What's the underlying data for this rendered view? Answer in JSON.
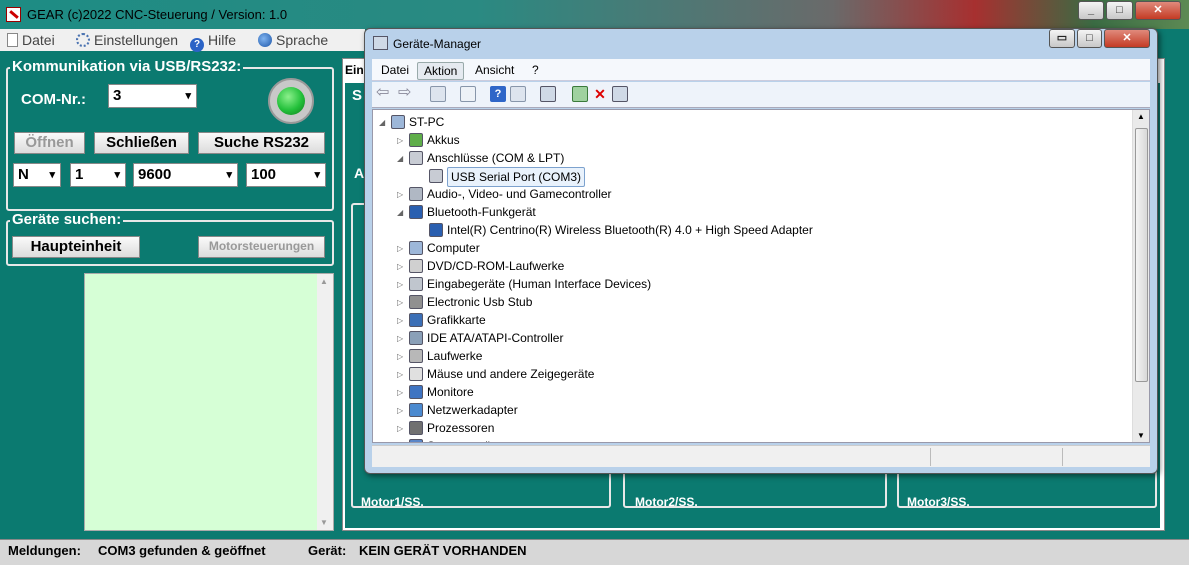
{
  "app": {
    "title": "GEAR (c)2022 CNC-Steuerung / Version: 1.0",
    "window_controls": [
      "_",
      "□",
      "✕"
    ],
    "menu": [
      "Datei",
      "Einstellungen",
      "Hilfe",
      "Sprache"
    ],
    "comm_group": {
      "title": "Kommunikation via USB/RS232:",
      "com_label": "COM-Nr.:",
      "com_value": "3",
      "status_led": "connected",
      "open_button": "Öffnen",
      "close_button": "Schließen",
      "search_button": "Suche RS232",
      "parity": "N",
      "stopbits": "1",
      "baud": "9600",
      "timeout": "100"
    },
    "device_group": {
      "title": "Geräte suchen:",
      "main_unit_button": "Haupteinheit",
      "motor_button": "Motorsteuerungen"
    },
    "right_tab_fragment": "Ein",
    "motor_fragments": [
      "Motor1/SS.",
      "Motor2/SS.",
      "Motor3/SS."
    ],
    "side_fragments": [
      "S",
      "A"
    ],
    "status": {
      "messages_label": "Meldungen:",
      "messages_value": "COM3 gefunden & geöffnet",
      "device_label": "Gerät:",
      "device_value": "KEIN GERÄT VORHANDEN"
    }
  },
  "device_manager": {
    "title": "Geräte-Manager",
    "window_controls": [
      "▭",
      "□",
      "✕"
    ],
    "menu": [
      "Datei",
      "Aktion",
      "Ansicht",
      "?"
    ],
    "active_menu": "Aktion",
    "tree": [
      {
        "label": "ST-PC",
        "level": 0,
        "expander": "◢",
        "icon": "computer-icon"
      },
      {
        "label": "Akkus",
        "level": 1,
        "expander": "▷",
        "icon": "battery-icon"
      },
      {
        "label": "Anschlüsse (COM & LPT)",
        "level": 1,
        "expander": "◢",
        "icon": "port-icon"
      },
      {
        "label": "USB Serial Port (COM3)",
        "level": 2,
        "expander": "",
        "icon": "port-icon",
        "selected": true
      },
      {
        "label": "Audio-, Video- und Gamecontroller",
        "level": 1,
        "expander": "▷",
        "icon": "speaker-icon"
      },
      {
        "label": "Bluetooth-Funkgerät",
        "level": 1,
        "expander": "◢",
        "icon": "bluetooth-icon"
      },
      {
        "label": "Intel(R) Centrino(R) Wireless Bluetooth(R) 4.0 + High Speed Adapter",
        "level": 2,
        "expander": "",
        "icon": "bluetooth-icon"
      },
      {
        "label": "Computer",
        "level": 1,
        "expander": "▷",
        "icon": "computer-icon"
      },
      {
        "label": "DVD/CD-ROM-Laufwerke",
        "level": 1,
        "expander": "▷",
        "icon": "disc-icon"
      },
      {
        "label": "Eingabegeräte (Human Interface Devices)",
        "level": 1,
        "expander": "▷",
        "icon": "hid-icon"
      },
      {
        "label": "Electronic Usb Stub",
        "level": 1,
        "expander": "▷",
        "icon": "usb-icon"
      },
      {
        "label": "Grafikkarte",
        "level": 1,
        "expander": "▷",
        "icon": "display-adapter-icon"
      },
      {
        "label": "IDE ATA/ATAPI-Controller",
        "level": 1,
        "expander": "▷",
        "icon": "ide-icon"
      },
      {
        "label": "Laufwerke",
        "level": 1,
        "expander": "▷",
        "icon": "drive-icon"
      },
      {
        "label": "Mäuse und andere Zeigegeräte",
        "level": 1,
        "expander": "▷",
        "icon": "mouse-icon"
      },
      {
        "label": "Monitore",
        "level": 1,
        "expander": "▷",
        "icon": "monitor-icon"
      },
      {
        "label": "Netzwerkadapter",
        "level": 1,
        "expander": "▷",
        "icon": "network-icon"
      },
      {
        "label": "Prozessoren",
        "level": 1,
        "expander": "▷",
        "icon": "cpu-icon"
      },
      {
        "label": "Systemgeräte",
        "level": 1,
        "expander": "▷",
        "icon": "system-icon"
      }
    ]
  },
  "colors": {
    "app_bg": "#0b7a70",
    "log_bg": "#d6ffd6",
    "led": "#22c03a"
  }
}
